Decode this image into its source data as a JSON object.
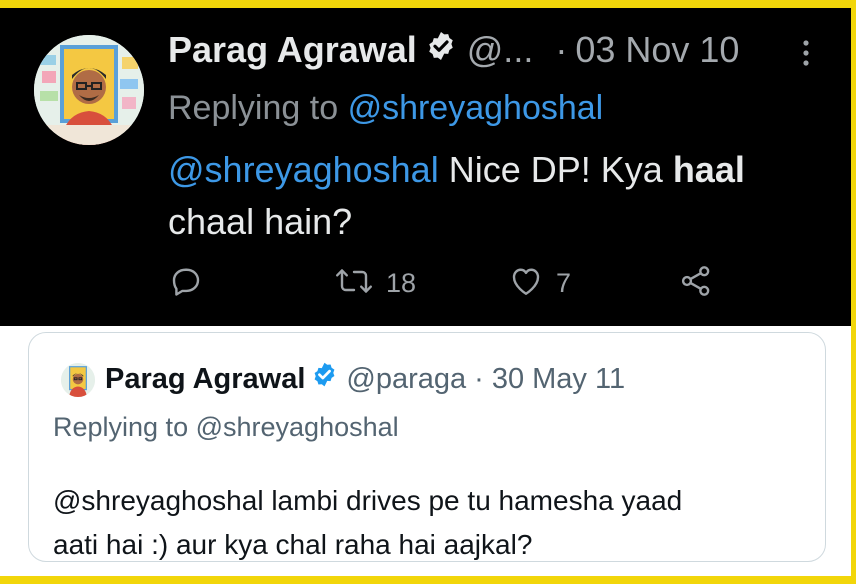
{
  "dark_tweet": {
    "author_name": "Parag Agrawal",
    "handle": "@...",
    "separator": "·",
    "date": "03 Nov 10",
    "replying_prefix": "Replying to",
    "replying_to": "@shreyaghoshal",
    "body": {
      "mention": "@shreyaghoshal",
      "text_1": "Nice DP! Kya",
      "bold": "haal",
      "text_2": "chaal hain?"
    },
    "actions": {
      "reply_icon": "reply-icon",
      "retweet_icon": "retweet-icon",
      "retweet_count": "18",
      "like_icon": "heart-icon",
      "like_count": "7",
      "share_icon": "share-icon"
    }
  },
  "light_tweet": {
    "author_name": "Parag Agrawal",
    "handle": "@paraga",
    "separator": "·",
    "date": "30 May 11",
    "replying_prefix": "Replying to",
    "replying_to": "@shreyaghoshal",
    "body_line_1": "@shreyaghoshal lambi drives pe tu hamesha yaad",
    "body_line_2": "aati hai :) aur kya chal raha hai aajkal?"
  },
  "colors": {
    "frame_yellow": "#f2d60a",
    "dark_bg": "#000000",
    "link_blue_dark": "#3d98e6",
    "verified_blue": "#1d9bf0",
    "text_light": "#e7e9ea",
    "text_muted_dark": "#a4a9ae",
    "text_dark": "#0f1419",
    "text_muted_light": "#536471"
  }
}
